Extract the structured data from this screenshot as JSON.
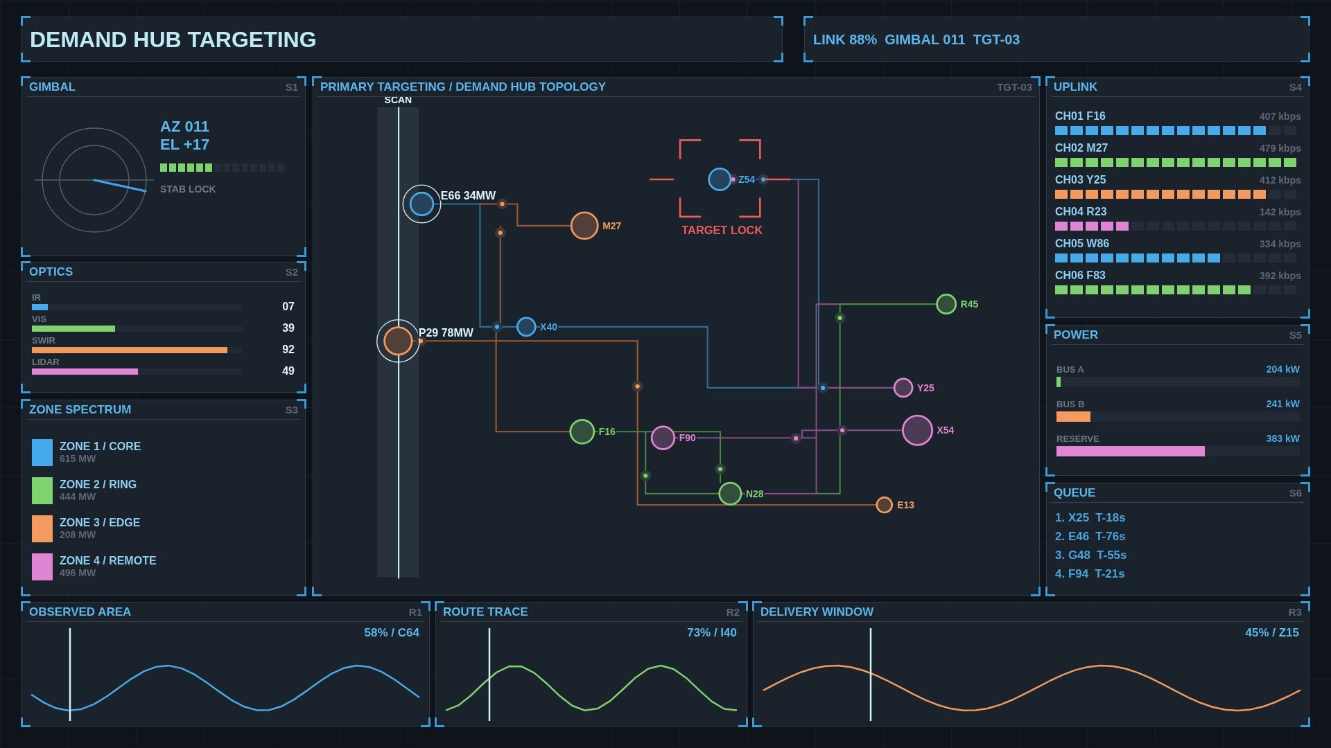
{
  "header": {
    "title": "DEMAND HUB TARGETING",
    "status": [
      "LINK 88%",
      "GIMBAL 011",
      "TGT-03"
    ]
  },
  "gimbal": {
    "title": "GIMBAL",
    "tag": "S1",
    "azimuth": "AZ 011",
    "elevation": "EL +17",
    "stability": {
      "label": "STAB LOCK",
      "level": 0.4286
    }
  },
  "optics": {
    "title": "OPTICS",
    "tag": "S2",
    "bands": [
      {
        "label": "IR",
        "value": "07",
        "level": 0.075,
        "color": "#45abea"
      },
      {
        "label": "VIS",
        "value": "39",
        "level": 0.395,
        "color": "#7ed36f"
      },
      {
        "label": "SWIR",
        "value": "92",
        "level": 0.93,
        "color": "#f49a5f"
      },
      {
        "label": "LIDAR",
        "value": "49",
        "level": 0.505,
        "color": "#e284d4"
      }
    ]
  },
  "zone_spectrum": {
    "title": "ZONE SPECTRUM",
    "tag": "S3",
    "zones": [
      {
        "label": "ZONE 1 / CORE",
        "value": "615 MW",
        "color": "#45abea"
      },
      {
        "label": "ZONE 2 / RING",
        "value": "444 MW",
        "color": "#7ed36f"
      },
      {
        "label": "ZONE 3 / EDGE",
        "value": "208 MW",
        "color": "#f49a5f"
      },
      {
        "label": "ZONE 4 / REMOTE",
        "value": "496 MW",
        "color": "#e284d4"
      }
    ]
  },
  "topology": {
    "title": "PRIMARY TARGETING / DEMAND HUB TOPOLOGY",
    "tag": "TGT-03",
    "scan_label": "SCAN",
    "nodes": [
      {
        "label": "E66 34MW",
        "kind": "hub",
        "color": "#45abea",
        "locked": false
      },
      {
        "label": "P29 78MW",
        "kind": "hub",
        "color": "#f49a5f",
        "locked": false
      },
      {
        "label": "M27",
        "kind": "node",
        "color": "#f49a5f",
        "locked": false
      },
      {
        "label": "X40",
        "kind": "node",
        "color": "#45abea",
        "locked": false
      },
      {
        "label": "Z54",
        "kind": "node",
        "color": "#45abea",
        "locked": true,
        "lock_label": "TARGET LOCK"
      },
      {
        "label": "R45",
        "kind": "node",
        "color": "#7ed36f",
        "locked": false
      },
      {
        "label": "Y25",
        "kind": "node",
        "color": "#e284d4",
        "locked": false
      },
      {
        "label": "X54",
        "kind": "node",
        "color": "#e284d4",
        "locked": false
      },
      {
        "label": "F16",
        "kind": "node",
        "color": "#7ed36f",
        "locked": false
      },
      {
        "label": "F90",
        "kind": "node",
        "color": "#e284d4",
        "locked": false
      },
      {
        "label": "N28",
        "kind": "node",
        "color": "#7ed36f",
        "locked": false
      },
      {
        "label": "E13",
        "kind": "node",
        "color": "#f49a5f",
        "locked": false
      }
    ]
  },
  "uplink": {
    "title": "UPLINK",
    "tag": "S4",
    "channels": [
      {
        "label": "CH01 F16",
        "reading": "407 kbps",
        "level": 0.875,
        "color": "#45abea"
      },
      {
        "label": "CH02 M27",
        "reading": "479 kbps",
        "level": 1,
        "color": "#7ed36f"
      },
      {
        "label": "CH03 Y25",
        "reading": "412 kbps",
        "level": 0.875,
        "color": "#f49a5f"
      },
      {
        "label": "CH04 R23",
        "reading": "142 kbps",
        "level": 0.3125,
        "color": "#e284d4"
      },
      {
        "label": "CH05 W86",
        "reading": "334 kbps",
        "level": 0.6875,
        "color": "#45abea"
      },
      {
        "label": "CH06 F83",
        "reading": "392 kbps",
        "level": 0.8125,
        "color": "#7ed36f"
      }
    ]
  },
  "power": {
    "title": "POWER",
    "tag": "S5",
    "buses": [
      {
        "label": "BUS A",
        "reading": "204 kW",
        "level": 0.016,
        "color": "#7ed36f"
      },
      {
        "label": "BUS B",
        "reading": "241 kW",
        "level": 0.14,
        "color": "#f49a5f"
      },
      {
        "label": "RESERVE",
        "reading": "383 kW",
        "level": 0.61,
        "color": "#e284d4"
      }
    ]
  },
  "queue": {
    "title": "QUEUE",
    "tag": "S6",
    "items": [
      {
        "target": "1. X25",
        "eta": "T-18s"
      },
      {
        "target": "2. E46",
        "eta": "T-76s"
      },
      {
        "target": "3. G48",
        "eta": "T-55s"
      },
      {
        "target": "4. F94",
        "eta": "T-21s"
      }
    ]
  },
  "traces": [
    {
      "title": "OBSERVED AREA",
      "tag": "R1",
      "reading": "58% / C64",
      "color": "#45abea"
    },
    {
      "title": "ROUTE TRACE",
      "tag": "R2",
      "reading": "73% / I40",
      "color": "#7ed36f"
    },
    {
      "title": "DELIVERY WINDOW",
      "tag": "R3",
      "reading": "45% / Z15",
      "color": "#f49a5f"
    }
  ]
}
